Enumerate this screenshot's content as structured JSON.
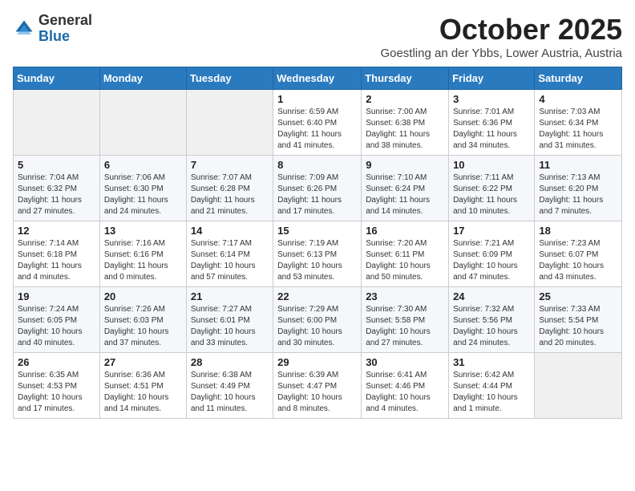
{
  "header": {
    "logo_general": "General",
    "logo_blue": "Blue",
    "month": "October 2025",
    "location": "Goestling an der Ybbs, Lower Austria, Austria"
  },
  "days_of_week": [
    "Sunday",
    "Monday",
    "Tuesday",
    "Wednesday",
    "Thursday",
    "Friday",
    "Saturday"
  ],
  "weeks": [
    [
      {
        "day": "",
        "info": ""
      },
      {
        "day": "",
        "info": ""
      },
      {
        "day": "",
        "info": ""
      },
      {
        "day": "1",
        "info": "Sunrise: 6:59 AM\nSunset: 6:40 PM\nDaylight: 11 hours\nand 41 minutes."
      },
      {
        "day": "2",
        "info": "Sunrise: 7:00 AM\nSunset: 6:38 PM\nDaylight: 11 hours\nand 38 minutes."
      },
      {
        "day": "3",
        "info": "Sunrise: 7:01 AM\nSunset: 6:36 PM\nDaylight: 11 hours\nand 34 minutes."
      },
      {
        "day": "4",
        "info": "Sunrise: 7:03 AM\nSunset: 6:34 PM\nDaylight: 11 hours\nand 31 minutes."
      }
    ],
    [
      {
        "day": "5",
        "info": "Sunrise: 7:04 AM\nSunset: 6:32 PM\nDaylight: 11 hours\nand 27 minutes."
      },
      {
        "day": "6",
        "info": "Sunrise: 7:06 AM\nSunset: 6:30 PM\nDaylight: 11 hours\nand 24 minutes."
      },
      {
        "day": "7",
        "info": "Sunrise: 7:07 AM\nSunset: 6:28 PM\nDaylight: 11 hours\nand 21 minutes."
      },
      {
        "day": "8",
        "info": "Sunrise: 7:09 AM\nSunset: 6:26 PM\nDaylight: 11 hours\nand 17 minutes."
      },
      {
        "day": "9",
        "info": "Sunrise: 7:10 AM\nSunset: 6:24 PM\nDaylight: 11 hours\nand 14 minutes."
      },
      {
        "day": "10",
        "info": "Sunrise: 7:11 AM\nSunset: 6:22 PM\nDaylight: 11 hours\nand 10 minutes."
      },
      {
        "day": "11",
        "info": "Sunrise: 7:13 AM\nSunset: 6:20 PM\nDaylight: 11 hours\nand 7 minutes."
      }
    ],
    [
      {
        "day": "12",
        "info": "Sunrise: 7:14 AM\nSunset: 6:18 PM\nDaylight: 11 hours\nand 4 minutes."
      },
      {
        "day": "13",
        "info": "Sunrise: 7:16 AM\nSunset: 6:16 PM\nDaylight: 11 hours\nand 0 minutes."
      },
      {
        "day": "14",
        "info": "Sunrise: 7:17 AM\nSunset: 6:14 PM\nDaylight: 10 hours\nand 57 minutes."
      },
      {
        "day": "15",
        "info": "Sunrise: 7:19 AM\nSunset: 6:13 PM\nDaylight: 10 hours\nand 53 minutes."
      },
      {
        "day": "16",
        "info": "Sunrise: 7:20 AM\nSunset: 6:11 PM\nDaylight: 10 hours\nand 50 minutes."
      },
      {
        "day": "17",
        "info": "Sunrise: 7:21 AM\nSunset: 6:09 PM\nDaylight: 10 hours\nand 47 minutes."
      },
      {
        "day": "18",
        "info": "Sunrise: 7:23 AM\nSunset: 6:07 PM\nDaylight: 10 hours\nand 43 minutes."
      }
    ],
    [
      {
        "day": "19",
        "info": "Sunrise: 7:24 AM\nSunset: 6:05 PM\nDaylight: 10 hours\nand 40 minutes."
      },
      {
        "day": "20",
        "info": "Sunrise: 7:26 AM\nSunset: 6:03 PM\nDaylight: 10 hours\nand 37 minutes."
      },
      {
        "day": "21",
        "info": "Sunrise: 7:27 AM\nSunset: 6:01 PM\nDaylight: 10 hours\nand 33 minutes."
      },
      {
        "day": "22",
        "info": "Sunrise: 7:29 AM\nSunset: 6:00 PM\nDaylight: 10 hours\nand 30 minutes."
      },
      {
        "day": "23",
        "info": "Sunrise: 7:30 AM\nSunset: 5:58 PM\nDaylight: 10 hours\nand 27 minutes."
      },
      {
        "day": "24",
        "info": "Sunrise: 7:32 AM\nSunset: 5:56 PM\nDaylight: 10 hours\nand 24 minutes."
      },
      {
        "day": "25",
        "info": "Sunrise: 7:33 AM\nSunset: 5:54 PM\nDaylight: 10 hours\nand 20 minutes."
      }
    ],
    [
      {
        "day": "26",
        "info": "Sunrise: 6:35 AM\nSunset: 4:53 PM\nDaylight: 10 hours\nand 17 minutes."
      },
      {
        "day": "27",
        "info": "Sunrise: 6:36 AM\nSunset: 4:51 PM\nDaylight: 10 hours\nand 14 minutes."
      },
      {
        "day": "28",
        "info": "Sunrise: 6:38 AM\nSunset: 4:49 PM\nDaylight: 10 hours\nand 11 minutes."
      },
      {
        "day": "29",
        "info": "Sunrise: 6:39 AM\nSunset: 4:47 PM\nDaylight: 10 hours\nand 8 minutes."
      },
      {
        "day": "30",
        "info": "Sunrise: 6:41 AM\nSunset: 4:46 PM\nDaylight: 10 hours\nand 4 minutes."
      },
      {
        "day": "31",
        "info": "Sunrise: 6:42 AM\nSunset: 4:44 PM\nDaylight: 10 hours\nand 1 minute."
      },
      {
        "day": "",
        "info": ""
      }
    ]
  ]
}
